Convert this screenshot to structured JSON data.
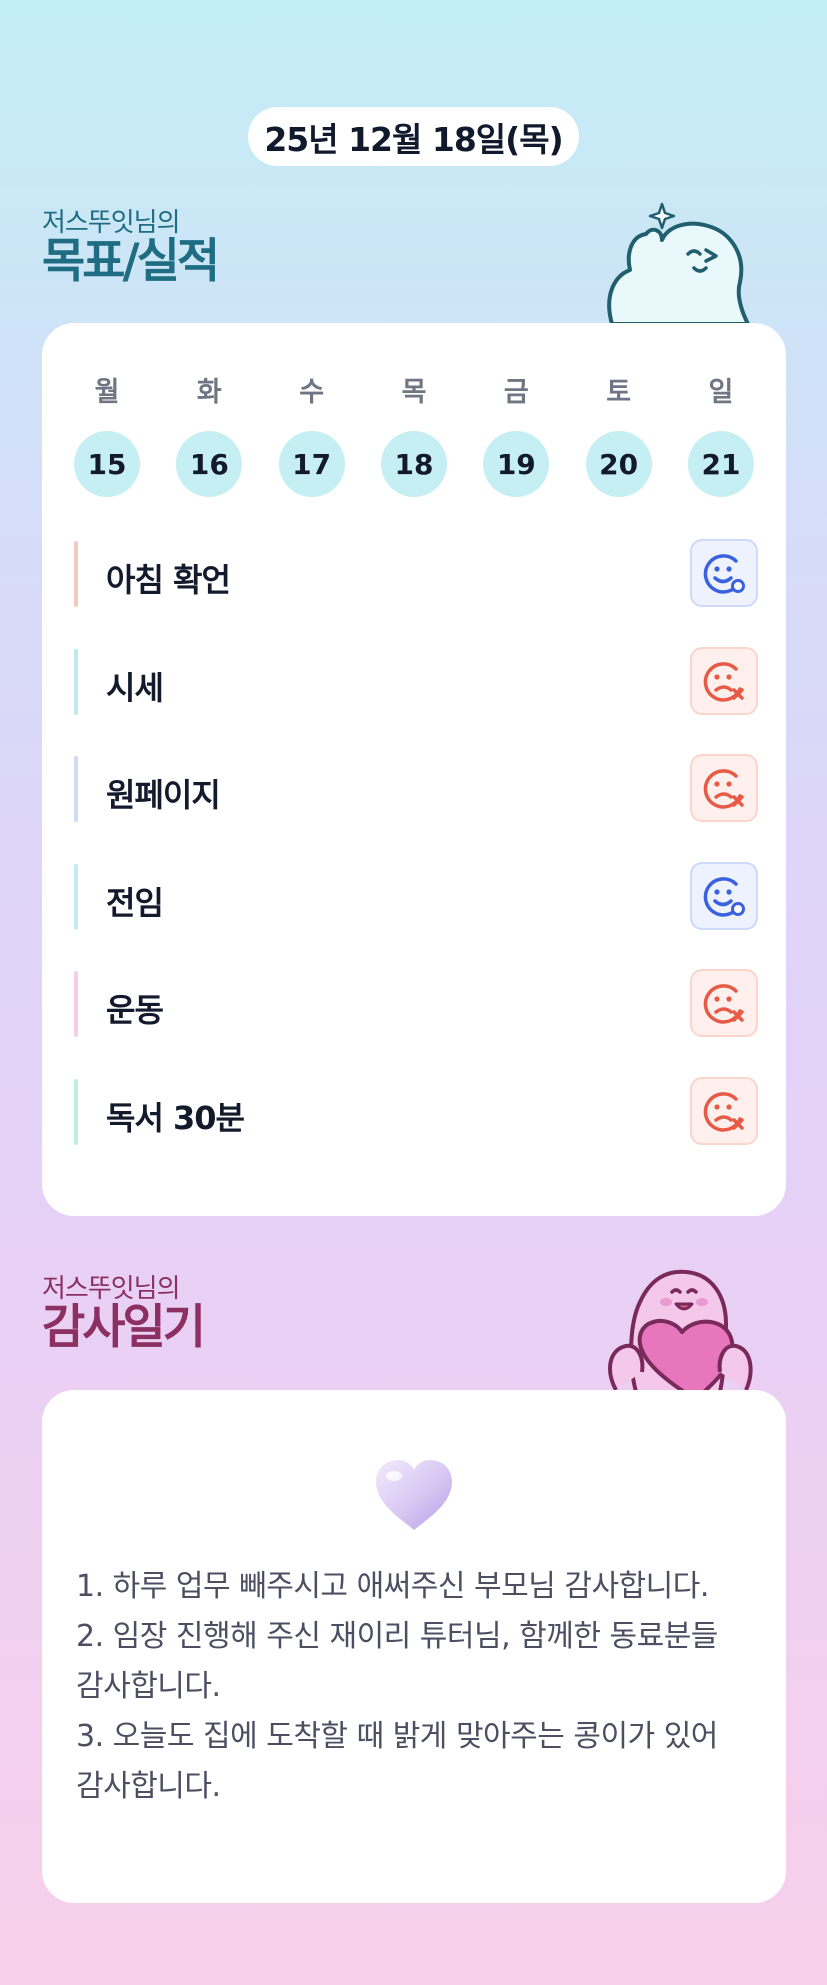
{
  "date": "25년 12월 18일(목)",
  "goal_section": {
    "subtitle": "저스뚜잇님의",
    "title": "목표/실적"
  },
  "week": [
    {
      "day": "월",
      "date": "15"
    },
    {
      "day": "화",
      "date": "16"
    },
    {
      "day": "수",
      "date": "17"
    },
    {
      "day": "목",
      "date": "18"
    },
    {
      "day": "금",
      "date": "19"
    },
    {
      "day": "토",
      "date": "20"
    },
    {
      "day": "일",
      "date": "21"
    }
  ],
  "goals": [
    {
      "label": "아침 확언",
      "status": "achieved",
      "accent": "#f6c9bf",
      "icon": "happy-face-icon"
    },
    {
      "label": "시세",
      "status": "missed",
      "accent": "#bfe9f1",
      "icon": "sad-face-x-icon"
    },
    {
      "label": "원페이지",
      "status": "missed",
      "accent": "#cfdcf4",
      "icon": "sad-face-x-icon"
    },
    {
      "label": "전임",
      "status": "achieved",
      "accent": "#c6eaf6",
      "icon": "happy-face-icon"
    },
    {
      "label": "운동",
      "status": "missed",
      "accent": "#f3cdea",
      "icon": "sad-face-x-icon"
    },
    {
      "label": "독서 30분",
      "status": "missed",
      "accent": "#bdeee0",
      "icon": "sad-face-x-icon"
    }
  ],
  "thanks_section": {
    "subtitle": "저스뚜잇님의",
    "title": "감사일기"
  },
  "thanks": [
    "1. 하루 업무 빼주시고 애써주신 부모님 감사합니다.",
    "2. 임장 진행해 주신 재이리 튜터님, 함께한 동료분들 감사합니다.",
    "3. 오늘도 집에 도착할 때 밝게 맞아주는 콩이가 있어 감사합니다."
  ],
  "colors": {
    "achieved": "#3a62e0",
    "missed": "#e85a45",
    "goal_title": "#1f6d83",
    "thanks_title": "#8c2f63"
  }
}
